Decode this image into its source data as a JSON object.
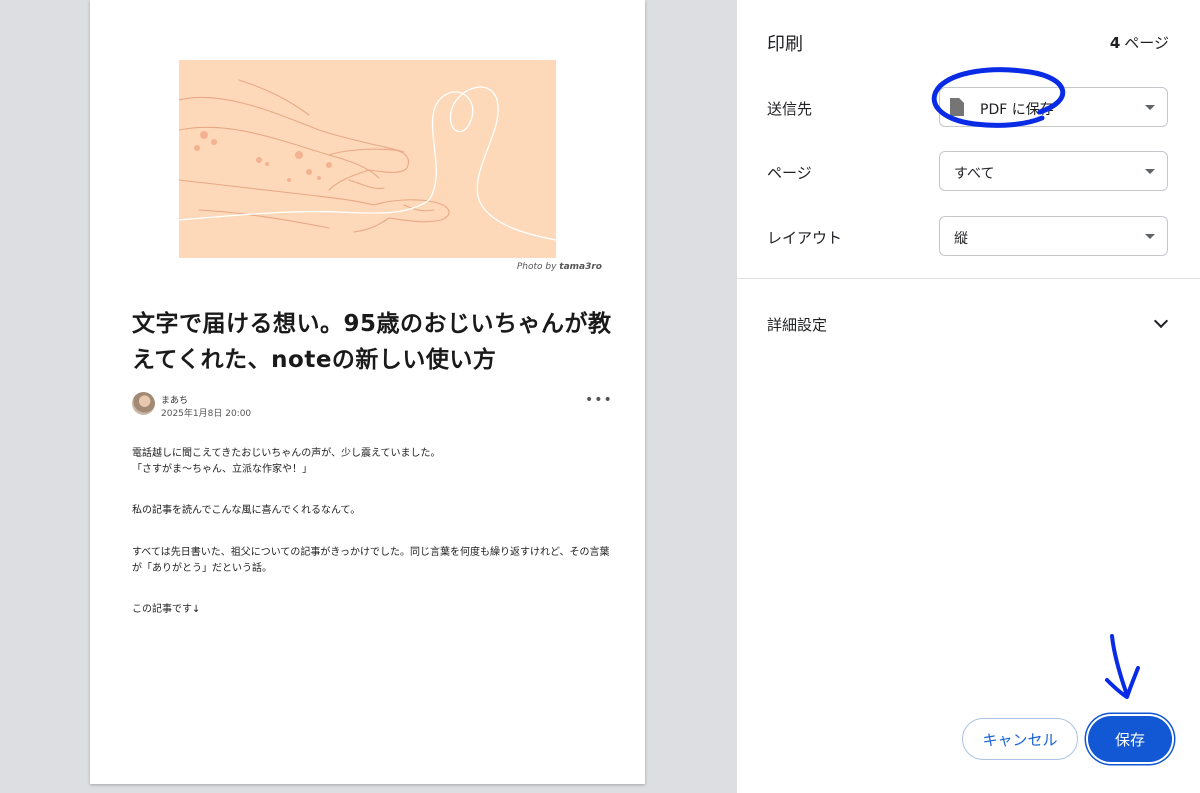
{
  "preview": {
    "photo_credit_prefix": "Photo by",
    "photo_credit_author": "tama3ro",
    "article_title": "文字で届ける想い。95歳のおじいちゃんが教えてくれた、noteの新しい使い方",
    "author": "まあち",
    "date": "2025年1月8日 20:00",
    "more_icon": "•••",
    "paragraphs": [
      "電話越しに聞こえてきたおじいちゃんの声が、少し震えていました。\n「さすがま〜ちゃん、立派な作家や！」",
      "私の記事を読んでこんな風に喜んでくれるなんて。",
      "すべては先日書いた、祖父についての記事がきっかけでした。同じ言葉を何度も繰り返すけれど、その言葉が「ありがとう」だという話。",
      "この記事です↓"
    ]
  },
  "panel": {
    "title": "印刷",
    "page_count_number": "4",
    "page_count_unit": "ページ",
    "destination_label": "送信先",
    "destination_value": "PDF に保存",
    "pages_label": "ページ",
    "pages_value": "すべて",
    "layout_label": "レイアウト",
    "layout_value": "縦",
    "advanced_label": "詳細設定",
    "cancel_label": "キャンセル",
    "save_label": "保存"
  },
  "colors": {
    "accent": "#1257d3",
    "annotation": "#0a2be6",
    "hero_bg": "#fdd9b9"
  }
}
